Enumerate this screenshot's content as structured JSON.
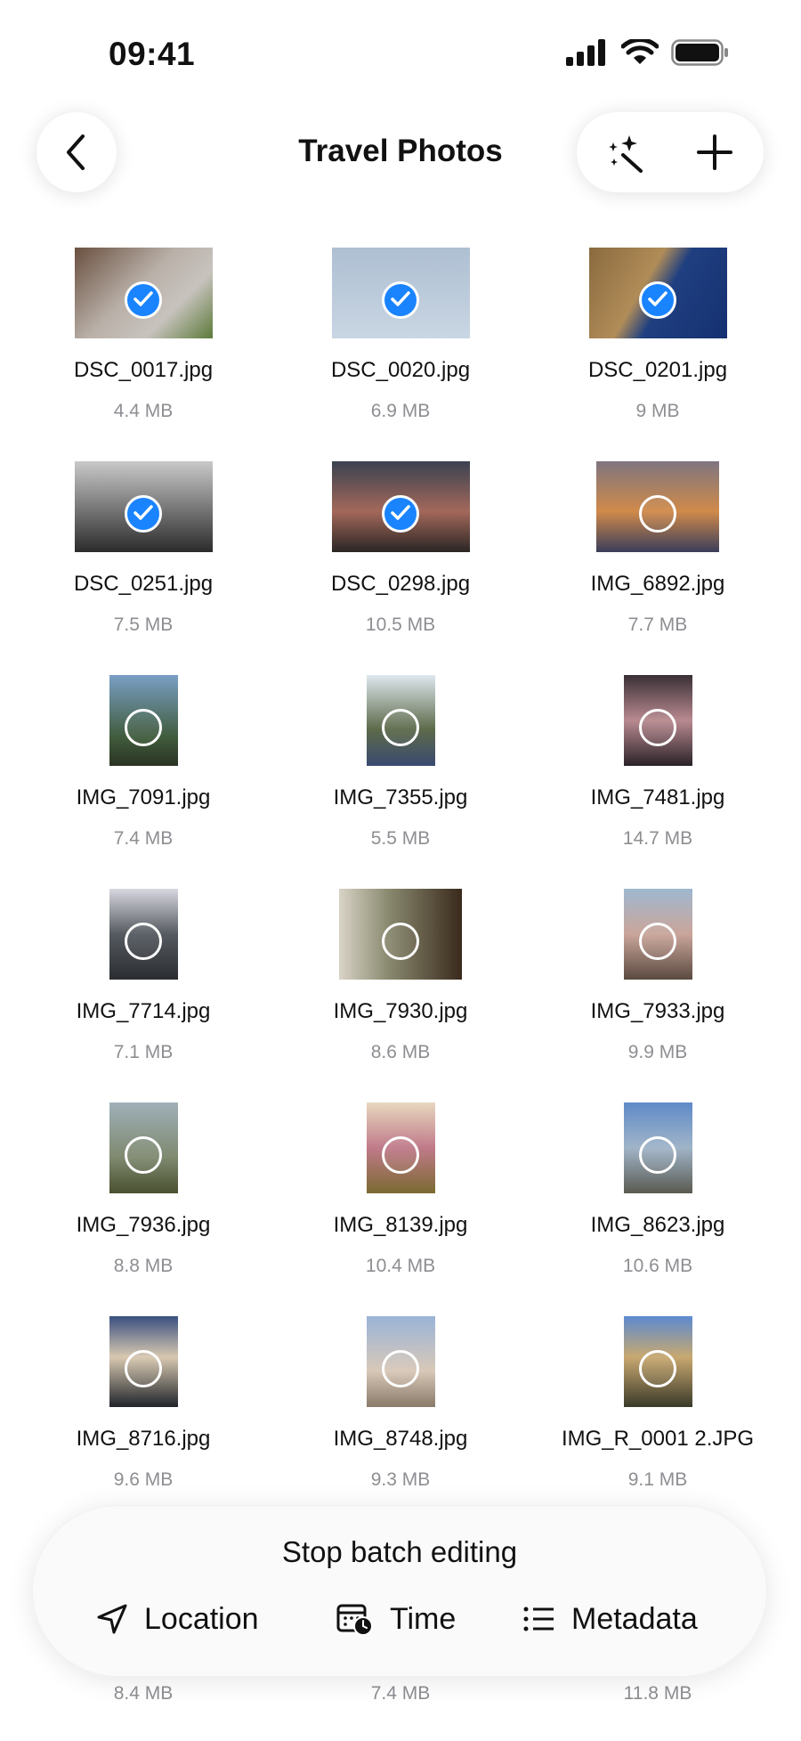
{
  "status_bar": {
    "time": "09:41"
  },
  "header": {
    "title": "Travel Photos"
  },
  "photos": [
    {
      "name": "DSC_0017.jpg",
      "size": "4.4 MB",
      "selected": true
    },
    {
      "name": "DSC_0020.jpg",
      "size": "6.9 MB",
      "selected": true
    },
    {
      "name": "DSC_0201.jpg",
      "size": "9 MB",
      "selected": true
    },
    {
      "name": "DSC_0251.jpg",
      "size": "7.5 MB",
      "selected": true
    },
    {
      "name": "DSC_0298.jpg",
      "size": "10.5 MB",
      "selected": true
    },
    {
      "name": "IMG_6892.jpg",
      "size": "7.7 MB",
      "selected": false
    },
    {
      "name": "IMG_7091.jpg",
      "size": "7.4 MB",
      "selected": false
    },
    {
      "name": "IMG_7355.jpg",
      "size": "5.5 MB",
      "selected": false
    },
    {
      "name": "IMG_7481.jpg",
      "size": "14.7 MB",
      "selected": false
    },
    {
      "name": "IMG_7714.jpg",
      "size": "7.1 MB",
      "selected": false
    },
    {
      "name": "IMG_7930.jpg",
      "size": "8.6 MB",
      "selected": false
    },
    {
      "name": "IMG_7933.jpg",
      "size": "9.9 MB",
      "selected": false
    },
    {
      "name": "IMG_7936.jpg",
      "size": "8.8 MB",
      "selected": false
    },
    {
      "name": "IMG_8139.jpg",
      "size": "10.4 MB",
      "selected": false
    },
    {
      "name": "IMG_8623.jpg",
      "size": "10.6 MB",
      "selected": false
    },
    {
      "name": "IMG_8716.jpg",
      "size": "9.6 MB",
      "selected": false
    },
    {
      "name": "IMG_8748.jpg",
      "size": "9.3 MB",
      "selected": false
    },
    {
      "name": "IMG_R_0001 2.JPG",
      "size": "9.1 MB",
      "selected": false
    }
  ],
  "peek_sizes": [
    "8.4 MB",
    "7.4 MB",
    "11.8 MB"
  ],
  "toolbar": {
    "stop_label": "Stop batch editing",
    "location_label": "Location",
    "time_label": "Time",
    "metadata_label": "Metadata"
  },
  "colors": {
    "accent": "#1a84ff",
    "secondary_text": "#8e8e93"
  },
  "icons": [
    "back-chevron-icon",
    "magic-wand-icon",
    "plus-icon",
    "location-arrow-icon",
    "calendar-clock-icon",
    "list-icon"
  ]
}
